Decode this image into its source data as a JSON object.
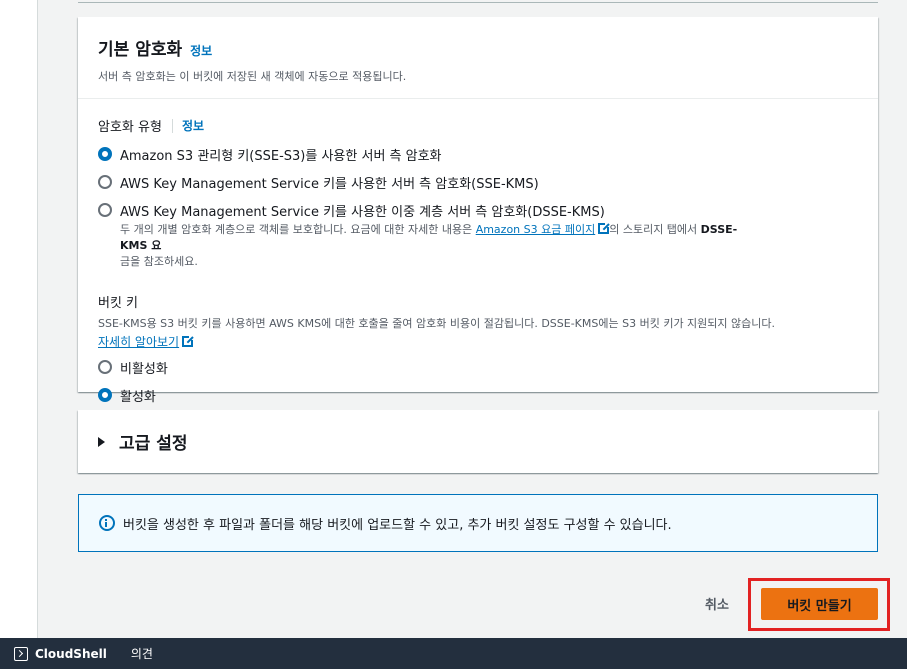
{
  "encryption": {
    "title": "기본 암호화",
    "info_link": "정보",
    "description": "서버 측 암호화는 이 버킷에 저장된 새 객체에 자동으로 적용됩니다.",
    "type_label": "암호화 유형",
    "type_info_link": "정보",
    "options": [
      {
        "label": "Amazon S3 관리형 키(SSE-S3)를 사용한 서버 측 암호화",
        "checked": true
      },
      {
        "label": "AWS Key Management Service 키를 사용한 서버 측 암호화(SSE-KMS)",
        "checked": false
      },
      {
        "label": "AWS Key Management Service 키를 사용한 이중 계층 서버 측 암호화(DSSE-KMS)",
        "checked": false
      }
    ],
    "dsse_desc_prefix": "두 개의 개별 암호화 계층으로 객체를 보호합니다. 요금에 대한 자세한 내용은 ",
    "dsse_pricing_link": "Amazon S3 요금 페이지",
    "dsse_desc_middle": "의 스토리지 탭에서 ",
    "dsse_desc_bold": "DSSE-KMS 요",
    "dsse_desc_suffix": "금을 참조하세요.",
    "bucket_key": {
      "label": "버킷 키",
      "description": "SSE-KMS용 S3 버킷 키를 사용하면 AWS KMS에 대한 호출을 줄여 암호화 비용이 절감됩니다. DSSE-KMS에는 S3 버킷 키가 지원되지 않습니다.",
      "learn_more": "자세히 알아보기",
      "options": [
        {
          "label": "비활성화",
          "checked": false
        },
        {
          "label": "활성화",
          "checked": true
        }
      ]
    }
  },
  "advanced": {
    "title": "고급 설정"
  },
  "alert": {
    "text": "버킷을 생성한 후 파일과 폴더를 해당 버킷에 업로드할 수 있고, 추가 버킷 설정도 구성할 수 있습니다."
  },
  "actions": {
    "cancel": "취소",
    "create": "버킷 만들기"
  },
  "footer": {
    "cloudshell": "CloudShell",
    "feedback": "의견"
  },
  "icons": [
    "info-circle-icon",
    "external-link-icon",
    "caret-right-icon",
    "cloudshell-icon"
  ],
  "colors": {
    "primary_button": "#ec7211",
    "link": "#0073bb",
    "footer_bg": "#232f3e",
    "highlight": "#e22222"
  }
}
